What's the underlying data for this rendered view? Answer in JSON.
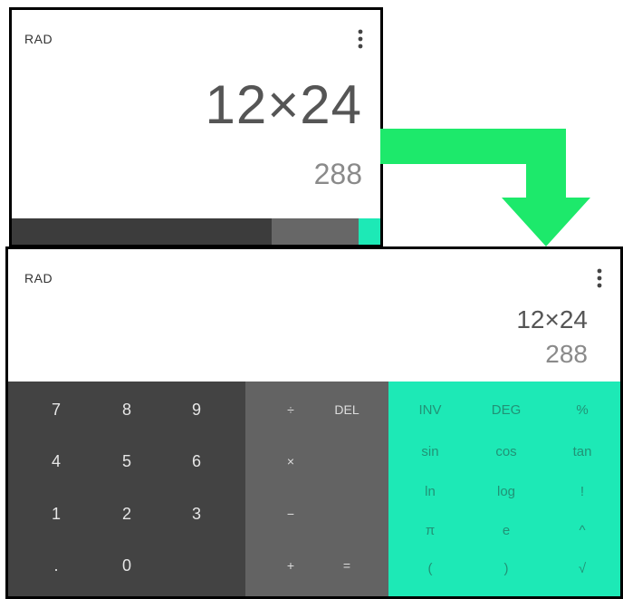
{
  "before": {
    "mode": "RAD",
    "expression": "12×24",
    "result": "288",
    "menu_icon": "more-vert-icon"
  },
  "after": {
    "mode": "RAD",
    "expression": "12×24",
    "result": "288",
    "menu_icon": "more-vert-icon",
    "digits": {
      "k7": "7",
      "k8": "8",
      "k9": "9",
      "k4": "4",
      "k5": "5",
      "k6": "6",
      "k1": "1",
      "k2": "2",
      "k3": "3",
      "dot": ".",
      "k0": "0"
    },
    "operators": {
      "divide": "÷",
      "del": "DEL",
      "multiply": "×",
      "minus": "−",
      "plus": "+",
      "equals": "="
    },
    "advanced": {
      "inv": "INV",
      "deg": "DEG",
      "percent": "%",
      "sin": "sin",
      "cos": "cos",
      "tan": "tan",
      "ln": "ln",
      "log": "log",
      "factorial": "!",
      "pi": "π",
      "e": "e",
      "power": "^",
      "lparen": "(",
      "rparen": ")",
      "sqrt": "√"
    }
  },
  "colors": {
    "accent": "#1de9b6",
    "digit_pad": "#434343",
    "operator_pad": "#636363",
    "arrow": "#1de96b"
  }
}
